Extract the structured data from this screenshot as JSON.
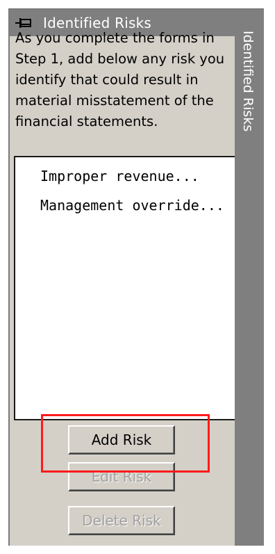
{
  "pane": {
    "title": "Identified Risks",
    "pin_icon": "pin-icon",
    "instructions": "As you complete the forms in Step 1, add below any risk you identify that could result in material misstatement of the financial statements."
  },
  "risks": [
    {
      "label": "Improper revenue..."
    },
    {
      "label": "Management override..."
    }
  ],
  "buttons": {
    "add": "Add Risk",
    "edit": "Edit Risk",
    "delete": "Delete Risk"
  },
  "side_tab": {
    "label": "Identified Risks"
  },
  "colors": {
    "highlight": "#ff1a1a",
    "titlebar": "#7f7f7f",
    "panel": "#d4d0c8"
  }
}
